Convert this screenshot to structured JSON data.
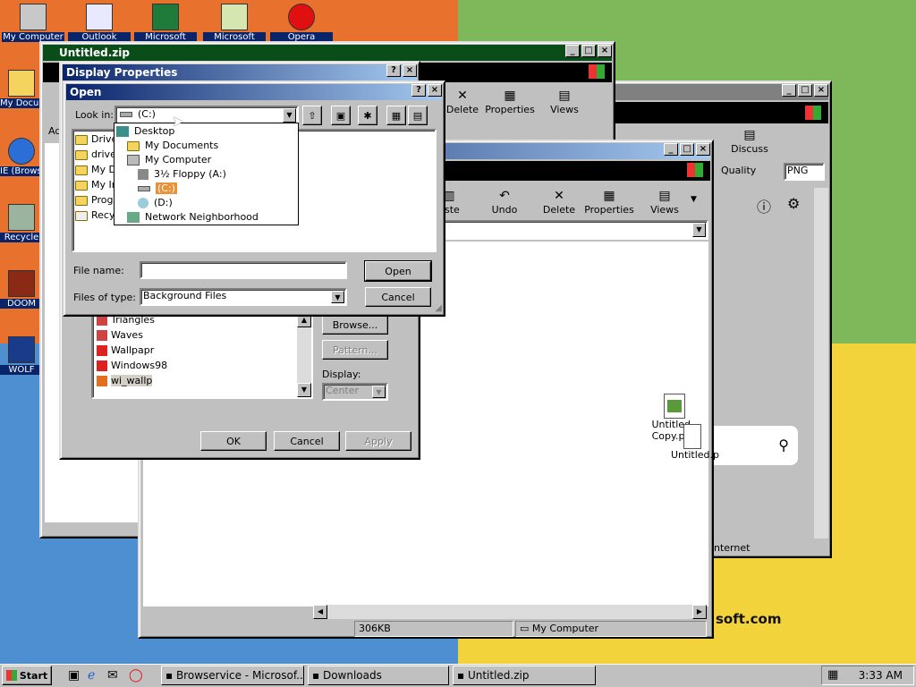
{
  "desktop": {
    "icons": [
      {
        "label": "My Computer",
        "icon": "computer-icon"
      },
      {
        "label": "Outlook",
        "icon": "mail-icon"
      },
      {
        "label": "Microsoft",
        "icon": "excel-icon"
      },
      {
        "label": "Microsoft",
        "icon": "document-icon"
      },
      {
        "label": "Opera",
        "icon": "opera-icon"
      },
      {
        "label": "My Documents",
        "icon": "folder-icon"
      },
      {
        "label": "IE (Browser)",
        "icon": "ie-icon"
      },
      {
        "label": "Recycle",
        "icon": "recycle-icon"
      },
      {
        "label": "DOOM",
        "icon": "doom-icon"
      },
      {
        "label": "WOLF",
        "icon": "wolf-icon"
      }
    ],
    "watermark": "soft.com"
  },
  "zip_window": {
    "title": "Untitled.zip",
    "address_label": "Ad"
  },
  "display_props": {
    "title": "Display Properties",
    "wallpapers": [
      "Triangles",
      "Waves",
      "Wallpapr",
      "Windows98",
      "wi_wallp"
    ],
    "browse_label": "Browse...",
    "pattern_label": "Pattern...",
    "display_label": "Display:",
    "display_value": "Center",
    "ok_label": "OK",
    "cancel_label": "Cancel",
    "apply_label": "Apply"
  },
  "open_dialog": {
    "title": "Open",
    "look_in_label": "Look in:",
    "look_in_value": "(C:)",
    "dropdown": [
      {
        "label": "Desktop",
        "indent": 0,
        "icon": "desktop-icon"
      },
      {
        "label": "My Documents",
        "indent": 1,
        "icon": "folder-icon"
      },
      {
        "label": "My Computer",
        "indent": 1,
        "icon": "computer-icon"
      },
      {
        "label": "3½ Floppy (A:)",
        "indent": 2,
        "icon": "floppy-icon"
      },
      {
        "label": "(C:)",
        "indent": 2,
        "icon": "drive-icon"
      },
      {
        "label": "(D:)",
        "indent": 2,
        "icon": "cd-icon"
      },
      {
        "label": "Network Neighborhood",
        "indent": 1,
        "icon": "network-icon"
      }
    ],
    "files": [
      "Driver",
      "driver",
      "My Do",
      "My Ins",
      "Progra",
      "Recyc"
    ],
    "file_name_label": "File name:",
    "file_name_value": "",
    "file_type_label": "Files of type:",
    "file_type_value": "Background Files",
    "open_label": "Open",
    "cancel_label": "Cancel"
  },
  "explorer_back": {
    "toolbar": [
      "Delete",
      "Properties",
      "Views"
    ],
    "discuss_label": "Discuss",
    "quality_label": "Quality",
    "quality_value": "PNG",
    "status_zone": "nternet"
  },
  "explorer_front": {
    "toolbar": [
      "aste",
      "Undo",
      "Delete",
      "Properties",
      "Views"
    ],
    "files": [
      {
        "label": "Untitled - Copy.png"
      },
      {
        "label": "Untitled.p"
      }
    ],
    "status_size": "306KB",
    "status_location": "My Computer"
  },
  "taskbar": {
    "start_label": "Start",
    "tasks": [
      "Browservice - Microsof...",
      "Downloads",
      "Untitled.zip"
    ],
    "clock": "3:33 AM"
  },
  "colors": {
    "title_active": "#0a246a",
    "title_green": "#0b4d18",
    "face": "#c0c0c0"
  }
}
